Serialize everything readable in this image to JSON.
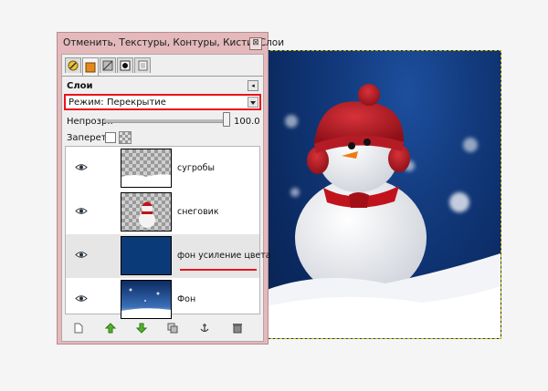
{
  "window": {
    "title": "Отменить, Текстуры, Контуры, Кисти, Слои",
    "close_glyph": "⊠"
  },
  "tabs": [
    {
      "icon": "paint-tools-icon",
      "active": false
    },
    {
      "icon": "layers-icon",
      "active": true
    },
    {
      "icon": "channels-icon",
      "active": false
    },
    {
      "icon": "paths-icon",
      "active": false
    },
    {
      "icon": "undo-history-icon",
      "active": false
    }
  ],
  "layers_panel": {
    "title": "Слои",
    "menu_glyph": "◂",
    "mode_label": "Режим:",
    "mode_value": "Перекрытие",
    "opacity_label": "Непрозр.:",
    "opacity_value": "100.0",
    "opacity_fraction": 1.0,
    "lock_label": "Запереть:"
  },
  "layers": [
    {
      "name": "сугробы",
      "visible": true,
      "selected": false,
      "thumb": "snowdrifts"
    },
    {
      "name": "снеговик",
      "visible": true,
      "selected": false,
      "thumb": "snowman"
    },
    {
      "name": "фон усиление цвета",
      "visible": true,
      "selected": true,
      "thumb": "solid-blue"
    },
    {
      "name": "Фон",
      "visible": true,
      "selected": false,
      "thumb": "background"
    }
  ],
  "bottom_bar": [
    "new-layer-icon",
    "raise-layer-icon",
    "lower-layer-icon",
    "duplicate-layer-icon",
    "anchor-layer-icon",
    "delete-layer-icon"
  ],
  "colors": {
    "highlight_red": "#e8141c",
    "window_frame": "#e3b9bb",
    "layer_blue": "#0b3a78"
  }
}
